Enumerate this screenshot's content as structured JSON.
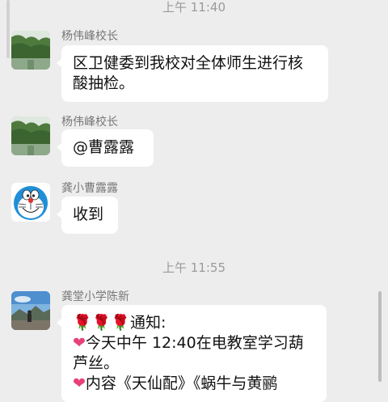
{
  "chat": {
    "timestamps": [
      "上午 11:40",
      "上午 11:55"
    ],
    "messages": [
      {
        "sender": "杨伟峰校长",
        "avatar": "tree-landscape-avatar",
        "lines": [
          "区卫健委到我校对全体师生进行核",
          "酸抽检。"
        ]
      },
      {
        "sender": "杨伟峰校长",
        "avatar": "tree-landscape-avatar",
        "lines": [
          "@曹露露"
        ]
      },
      {
        "sender": "龚小曹露露",
        "avatar": "doraemon-avatar",
        "lines": [
          "收到"
        ]
      },
      {
        "sender": "龚堂小学陈新",
        "avatar": "scenic-photo-avatar",
        "notice_label": "通知:",
        "lines": [
          "今天中午 12:40在电教室学习葫",
          "芦丝。",
          "内容《天仙配》《蜗牛与黄鹂"
        ]
      }
    ]
  },
  "colors": {
    "background": "#ededed",
    "bubble": "#ffffff",
    "timestamp": "#9a9a9a",
    "sender": "#777777",
    "rose": "#d6243a",
    "heart": "#e7407a"
  }
}
